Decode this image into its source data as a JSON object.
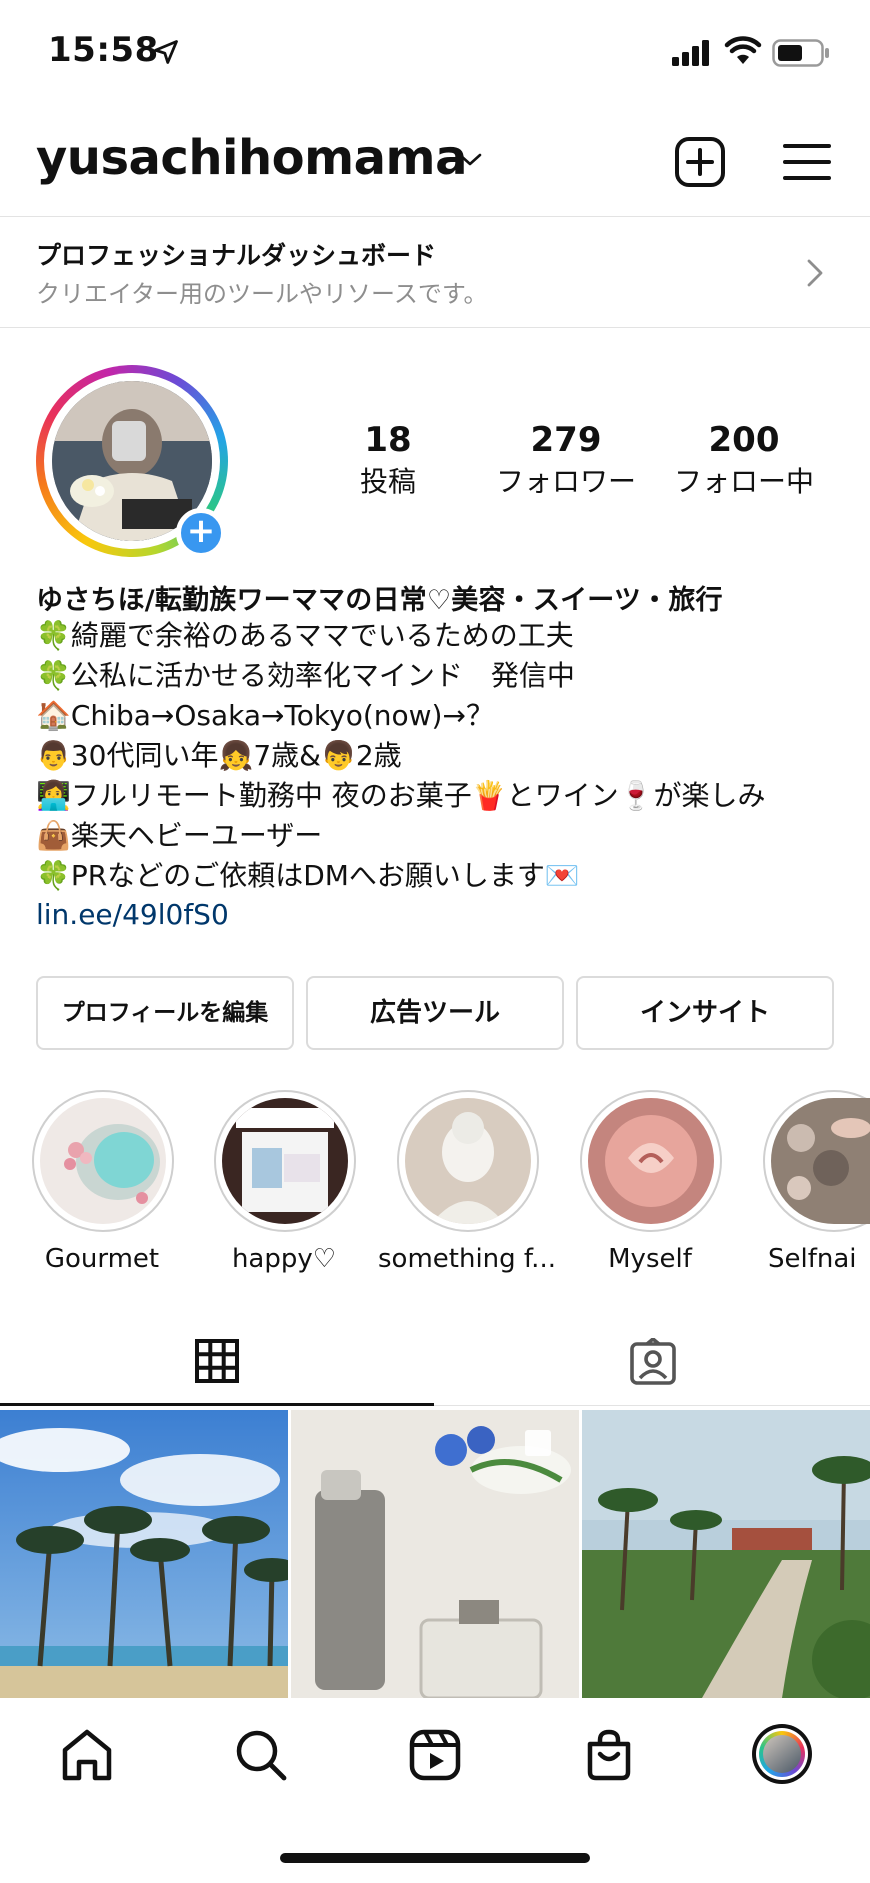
{
  "status_bar": {
    "time": "15:58"
  },
  "header": {
    "username": "yusachihomama"
  },
  "pro_dashboard": {
    "title": "プロフェッショナルダッシュボード",
    "subtitle": "クリエイター用のツールやリソースです。"
  },
  "stats": [
    {
      "value": "18",
      "label": "投稿"
    },
    {
      "value": "279",
      "label": "フォロワー"
    },
    {
      "value": "200",
      "label": "フォロー中"
    }
  ],
  "bio": {
    "name": "ゆさちほ/転勤族ワーママの日常♡美容・スイーツ・旅行",
    "lines": [
      "🍀綺麗で余裕のあるママでいるための工夫",
      "🍀公私に活かせる効率化マインド　発信中",
      "🏠Chiba→Osaka→Tokyo(now)→？",
      "👨30代同い年👧7歳&👦2歳",
      "👩‍💻フルリモート勤務中 夜のお菓子🍟とワイン🍷が楽しみ",
      "👜楽天ヘビーユーザー",
      "🍀PRなどのご依頼はDMへお願いします💌"
    ],
    "link": "lin.ee/49l0fS0"
  },
  "buttons": {
    "edit_profile": "プロフィールを編集",
    "ad_tools": "広告ツール",
    "insights": "インサイト"
  },
  "highlights": [
    {
      "label": "Gourmet"
    },
    {
      "label": "happy♡"
    },
    {
      "label": "something f..."
    },
    {
      "label": "Myself"
    },
    {
      "label": "Selfnai"
    }
  ],
  "colors": {
    "accent_blue": "#3897f0",
    "link": "#00376b",
    "muted": "#8e8e8e",
    "border": "#dbdbdb"
  }
}
